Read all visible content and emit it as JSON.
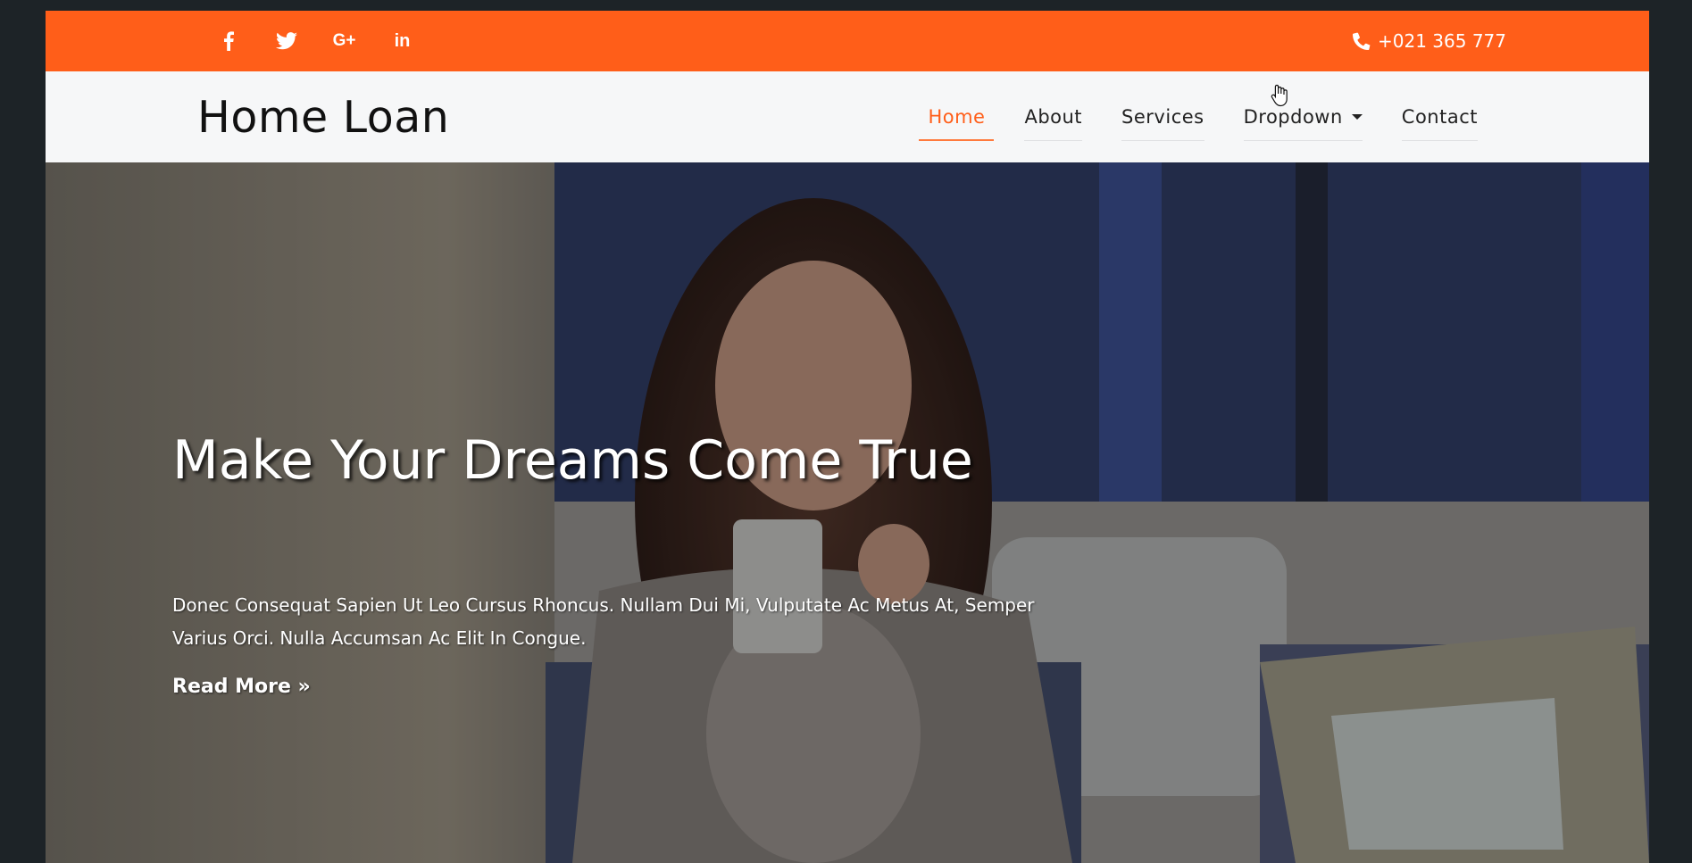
{
  "topbar": {
    "social": [
      {
        "icon": "facebook-icon",
        "glyph": "f"
      },
      {
        "icon": "twitter-icon",
        "glyph": "🐦"
      },
      {
        "icon": "google-plus-icon",
        "glyph": "G+"
      },
      {
        "icon": "linkedin-icon",
        "glyph": "in"
      }
    ],
    "phone": "+021 365 777",
    "phone_icon": "phone-icon",
    "accent": "#ff5e19"
  },
  "navbar": {
    "brand": "Home Loan",
    "items": [
      {
        "label": "Home",
        "active": true
      },
      {
        "label": "About"
      },
      {
        "label": "Services"
      },
      {
        "label": "Dropdown",
        "has_caret": true
      },
      {
        "label": "Contact"
      }
    ]
  },
  "hero": {
    "title": "Make Your Dreams Come True",
    "text": "Donec Consequat Sapien Ut Leo Cursus Rhoncus. Nullam Dui Mi, Vulputate Ac Metus At, Semper Varius Orci. Nulla Accumsan Ac Elit In Congue.",
    "cta": "Read More »"
  }
}
